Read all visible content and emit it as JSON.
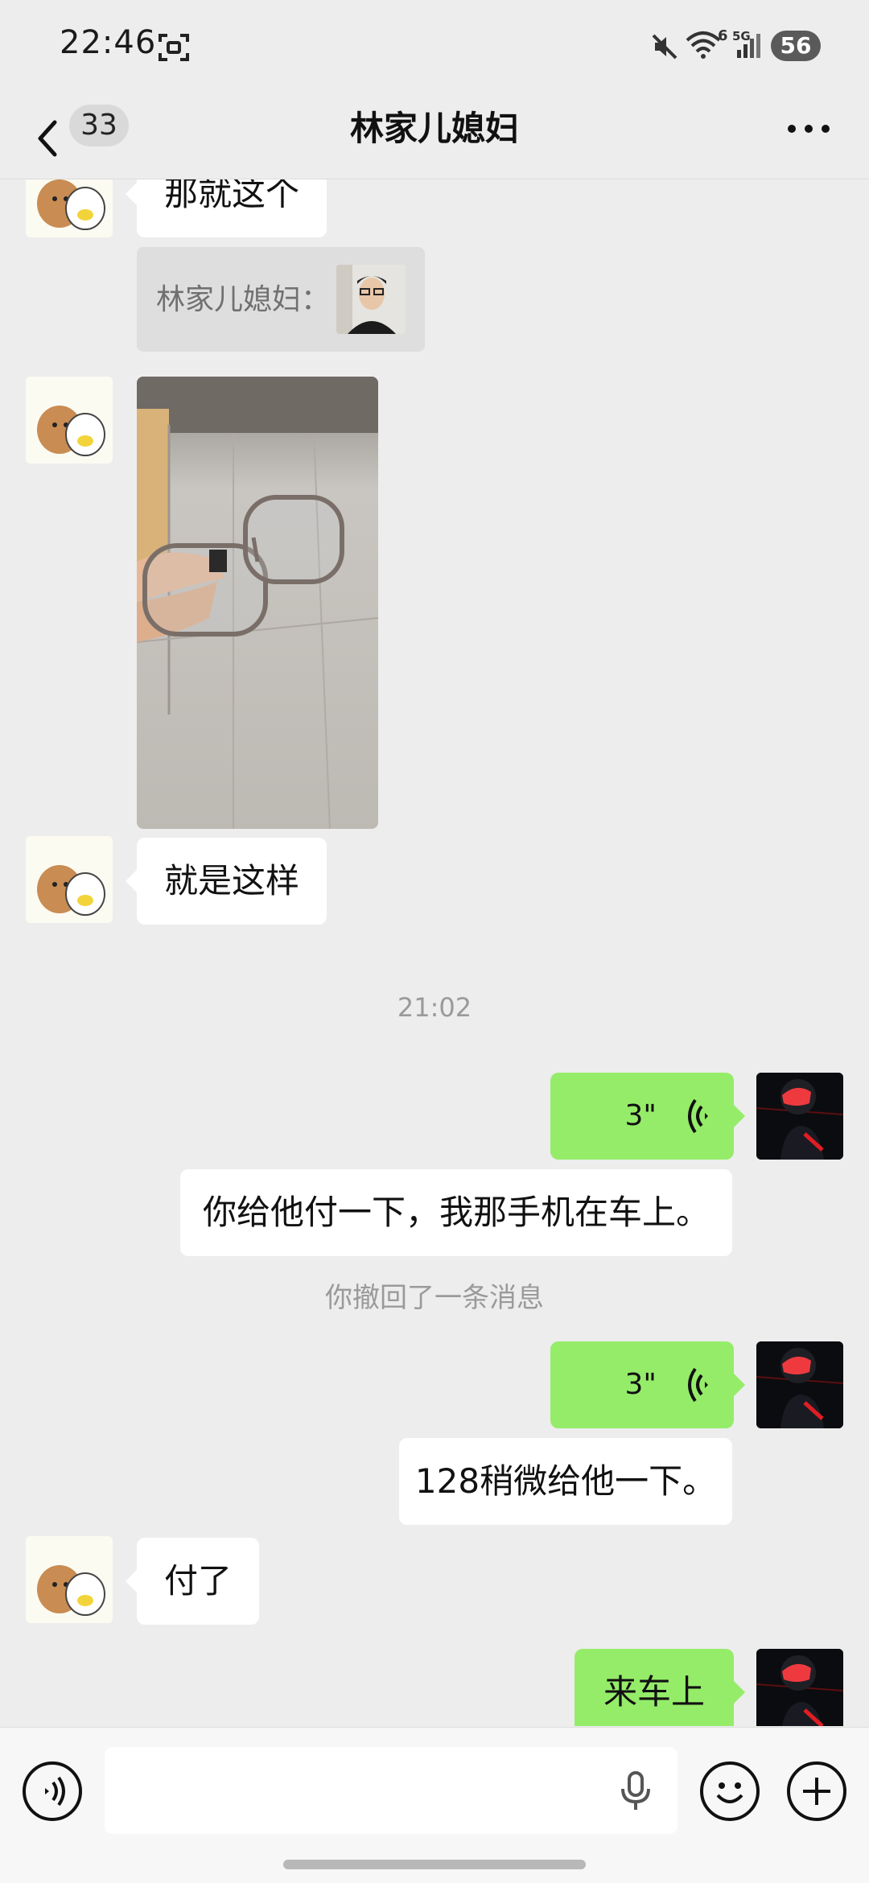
{
  "status_bar": {
    "time": "22:46",
    "wifi_badge": "6",
    "network_label": "5G",
    "battery": "56",
    "icons": [
      "screenshot-icon",
      "mute-icon",
      "wifi-icon",
      "signal-icon",
      "battery-icon"
    ]
  },
  "header": {
    "unread_count": "33",
    "title": "林家儿媳妇",
    "icons": [
      "back-arrow-icon",
      "more-dots-icon"
    ]
  },
  "messages": [
    {
      "side": "left",
      "type": "text",
      "text": "那就这个"
    },
    {
      "side": "left",
      "type": "quote",
      "quote_label": "林家儿媳妇："
    },
    {
      "side": "left",
      "type": "image"
    },
    {
      "side": "left",
      "type": "text",
      "text": "就是这样"
    },
    {
      "type": "timestamp",
      "text": "21:02"
    },
    {
      "side": "right",
      "type": "voice",
      "duration": "3\""
    },
    {
      "side": "right",
      "type": "text",
      "text": "你给他付一下，我那手机在车上。"
    },
    {
      "type": "system",
      "text": "你撤回了一条消息"
    },
    {
      "side": "right",
      "type": "voice",
      "duration": "3\""
    },
    {
      "side": "right",
      "type": "text",
      "text": "128稍微给他一下。"
    },
    {
      "side": "left",
      "type": "text",
      "text": "付了"
    },
    {
      "side": "right",
      "type": "text",
      "text": "来车上"
    }
  ],
  "input_bar": {
    "icons": [
      "voice-mode-icon",
      "microphone-icon",
      "emoji-icon",
      "plus-icon"
    ]
  },
  "colors": {
    "background": "#ededed",
    "sent_bubble": "#95ec69",
    "received_bubble": "#ffffff",
    "timestamp_text": "#9a9a9a"
  }
}
